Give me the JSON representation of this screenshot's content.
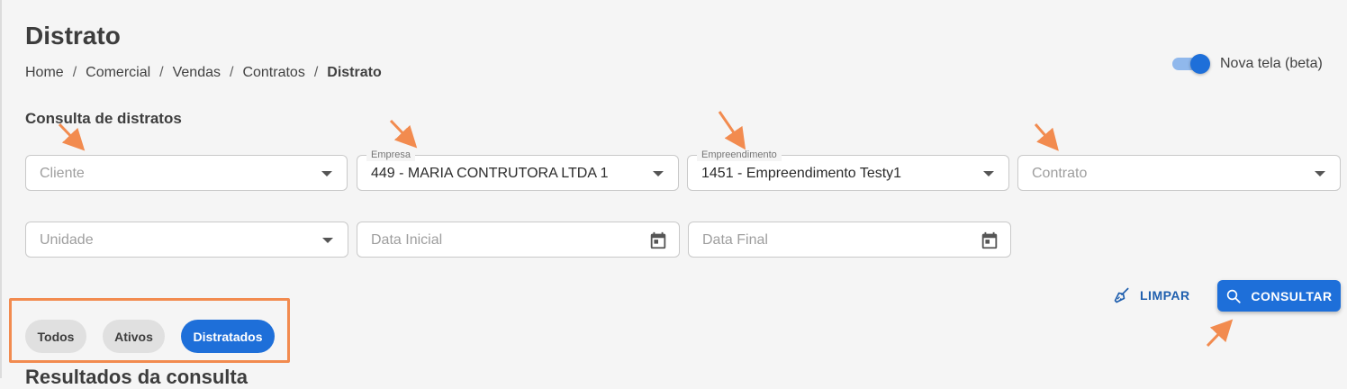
{
  "page": {
    "title": "Distrato"
  },
  "breadcrumb": [
    {
      "label": "Home"
    },
    {
      "label": "Comercial"
    },
    {
      "label": "Vendas"
    },
    {
      "label": "Contratos"
    },
    {
      "label": "Distrato",
      "current": true
    }
  ],
  "breadcrumb_separator": "/",
  "toggle": {
    "label": "Nova tela (beta)",
    "on": true
  },
  "search": {
    "section_title": "Consulta de distratos",
    "fields": {
      "cliente": {
        "placeholder": "Cliente",
        "value": ""
      },
      "empresa": {
        "label": "Empresa",
        "value": "449 - MARIA CONTRUTORA LTDA 1"
      },
      "empreendimento": {
        "label": "Empreendimento",
        "value": "1451 - Empreendimento Testy1"
      },
      "contrato": {
        "placeholder": "Contrato",
        "value": ""
      },
      "unidade": {
        "placeholder": "Unidade",
        "value": ""
      },
      "data_inicial": {
        "placeholder": "Data Inicial",
        "value": ""
      },
      "data_final": {
        "placeholder": "Data Final",
        "value": ""
      }
    },
    "actions": {
      "limpar": "LIMPAR",
      "consultar": "CONSULTAR"
    }
  },
  "filters": {
    "chips": [
      {
        "label": "Todos",
        "active": false
      },
      {
        "label": "Ativos",
        "active": false
      },
      {
        "label": "Distratados",
        "active": true
      }
    ]
  },
  "results": {
    "title": "Resultados da consulta"
  },
  "colors": {
    "primary": "#1e6fd9",
    "annotation": "#f28b4f",
    "background": "#f5f5f5"
  }
}
